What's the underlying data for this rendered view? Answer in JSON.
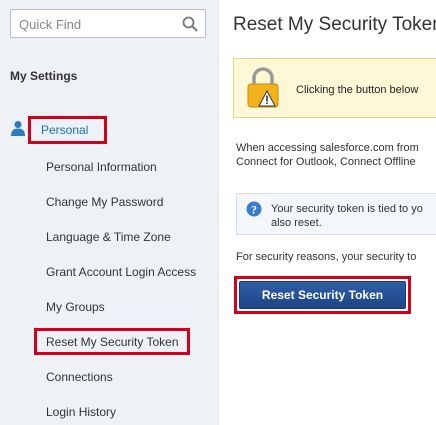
{
  "search": {
    "placeholder": "Quick Find"
  },
  "sidebar": {
    "title": "My Settings",
    "section_label": "Personal",
    "items": [
      {
        "label": "Personal Information"
      },
      {
        "label": "Change My Password"
      },
      {
        "label": "Language & Time Zone"
      },
      {
        "label": "Grant Account Login Access"
      },
      {
        "label": "My Groups"
      },
      {
        "label": "Reset My Security Token"
      },
      {
        "label": "Connections"
      },
      {
        "label": "Login History"
      }
    ]
  },
  "main": {
    "title": "Reset My Security Token",
    "warning_text": "Clicking the button below",
    "paragraph1": [
      "When accessing salesforce.com from",
      "Connect for Outlook, Connect Offline"
    ],
    "info": [
      "Your security token is tied to yo",
      "also reset."
    ],
    "paragraph2": "For security reasons, your security to",
    "button_label": "Reset Security Token"
  },
  "colors": {
    "highlight": "#d0021b",
    "link": "#1b6fb7",
    "button": "#25529a",
    "sidebar_bg": "#eef1f6",
    "warning_bg": "#fef8d6"
  }
}
